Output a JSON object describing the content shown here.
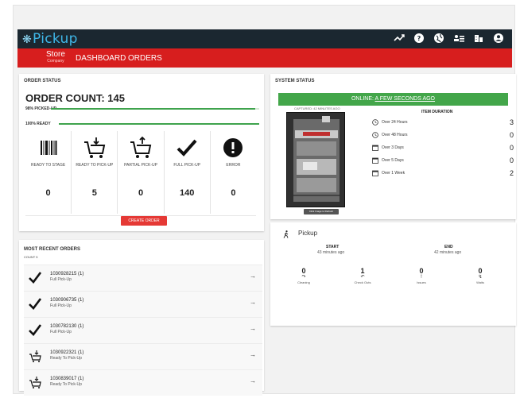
{
  "app": {
    "logo": "Pickup"
  },
  "nav": {
    "store_label": "Store",
    "store_sub": "Company",
    "dashboard": "DASHBOARD",
    "orders": "ORDERS"
  },
  "order_status": {
    "title": "ORDER STATUS",
    "count_label": "ORDER COUNT: 145",
    "picked_label": "98% PICKED-UP",
    "picked_pct": 98,
    "ready_label": "100% READY",
    "ready_pct": 100,
    "tiles": [
      {
        "label": "READY TO STAGE",
        "value": "0",
        "icon": "barcode-icon"
      },
      {
        "label": "READY TO PICK-UP",
        "value": "5",
        "icon": "cart-down-icon"
      },
      {
        "label": "PARTIAL PICK-UP",
        "value": "0",
        "icon": "cart-up-icon"
      },
      {
        "label": "FULL PICK-UP",
        "value": "140",
        "icon": "check-icon"
      },
      {
        "label": "ERROR",
        "value": "0",
        "icon": "error-icon"
      }
    ],
    "create_button": "CREATE ORDER"
  },
  "recent_orders": {
    "title": "MOST RECENT ORDERS",
    "count": "COUNT 5",
    "items": [
      {
        "id": "1030928215 (1)",
        "status": "Full Pick-Up",
        "icon": "check-icon"
      },
      {
        "id": "1030906735 (1)",
        "status": "Full Pick-Up",
        "icon": "check-icon"
      },
      {
        "id": "1030782130 (1)",
        "status": "Full Pick-Up",
        "icon": "check-icon"
      },
      {
        "id": "1030922321 (1)",
        "status": "Ready To Pick-Up",
        "icon": "cart-down-icon"
      },
      {
        "id": "1030839017 (1)",
        "status": "Ready To Pick-Up",
        "icon": "cart-down-icon"
      }
    ]
  },
  "system_status": {
    "title": "SYSTEM STATUS",
    "online_prefix": "ONLINE: ",
    "online_time": "A FEW SECONDS AGO",
    "captured": "CAPTURED: 42 MINUTES AGO",
    "photo_tag": "Click Image to Refresh",
    "duration_head": "ITEM DURATION",
    "durations": [
      {
        "label": "Over 24 Hours",
        "value": "3",
        "icon": "clock-icon"
      },
      {
        "label": "Over 48 Hours",
        "value": "0",
        "icon": "clock-icon"
      },
      {
        "label": "Over 3 Days",
        "value": "0",
        "icon": "calendar-icon"
      },
      {
        "label": "Over 5 Days",
        "value": "0",
        "icon": "calendar-icon"
      },
      {
        "label": "Over 1 Week",
        "value": "2",
        "icon": "calendar-icon"
      }
    ]
  },
  "pickup": {
    "title": "Pickup",
    "start_label": "START",
    "start_value": "43 minutes ago",
    "end_label": "END",
    "end_value": "42 minutes ago",
    "stats": [
      {
        "value": "0",
        "label": "Cleaning",
        "icon": "undo-icon"
      },
      {
        "value": "1",
        "label": "Check Outs",
        "icon": "return-icon"
      },
      {
        "value": "0",
        "label": "Issues",
        "icon": "alert-icon"
      },
      {
        "value": "0",
        "label": "Waits",
        "icon": "wait-icon"
      }
    ]
  },
  "colors": {
    "topbar": "#1b2730",
    "navbar": "#d71e1e",
    "online": "#43a64a",
    "accent": "#3fb7e8",
    "button": "#e53935"
  }
}
